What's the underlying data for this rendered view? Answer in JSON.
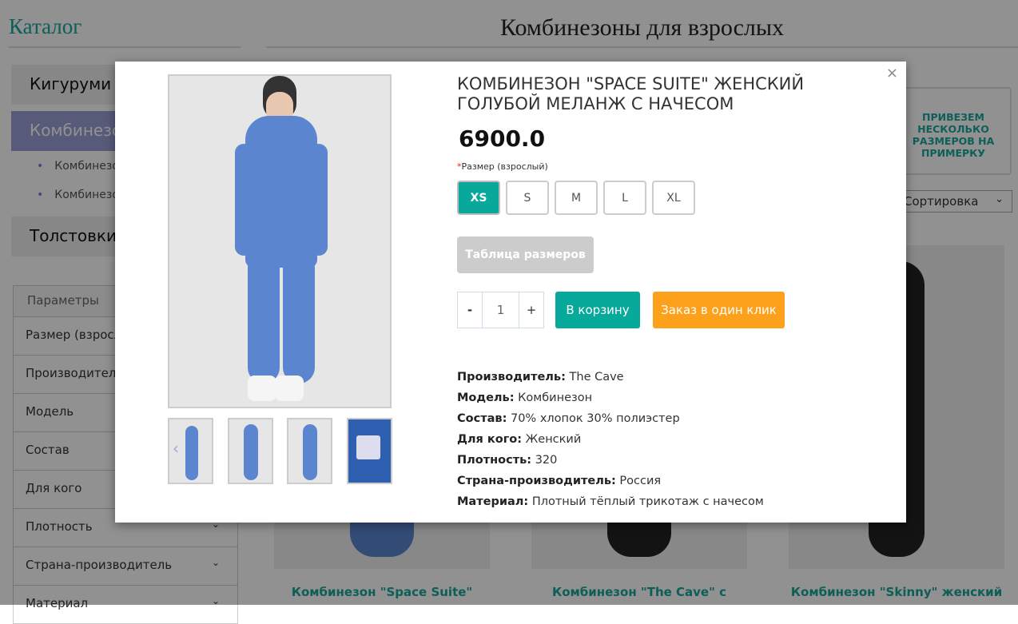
{
  "sidebar": {
    "title": "Каталог",
    "categories": [
      {
        "label": "Кигуруми"
      },
      {
        "label": "Комбинезоны",
        "active": true
      },
      {
        "label": "Толстовки"
      }
    ],
    "subcategories": [
      {
        "label": "Комбинезоны"
      },
      {
        "label": "Комбинезоны"
      }
    ],
    "filters": {
      "header": "Параметры",
      "items": [
        "Размер (взрослый)",
        "Производитель",
        "Модель",
        "Состав",
        "Для кого",
        "Плотность",
        "Страна-производитель",
        "Материал"
      ]
    }
  },
  "header": {
    "title": "Комбинезоны для взрослых"
  },
  "promo": {
    "text": "ПРИВЕЗЕМ НЕСКОЛЬКО РАЗМЕРОВ НА ПРИМЕРКУ"
  },
  "sort": {
    "value": "Сортировка"
  },
  "products": [
    {
      "title": "Комбинезон \"Space Suite\""
    },
    {
      "title": "Комбинезон \"The Cave\" с"
    },
    {
      "title": "Комбинезон \"Skinny\" женский"
    }
  ],
  "modal": {
    "close": "×",
    "title": "Комбинезон \"Space Suite\" женский голубой меланж с начесом",
    "price": "6900.0",
    "size_label": "Размер (взрослый)",
    "required_mark": "*",
    "sizes": [
      "XS",
      "S",
      "M",
      "L",
      "XL"
    ],
    "selected_size": "XS",
    "size_table_button": "Таблица размеров",
    "quantity": {
      "minus": "-",
      "value": "1",
      "plus": "+"
    },
    "cart_button": "В корзину",
    "one_click_button": "Заказ в один клик",
    "thumb_prev": "‹",
    "specs": [
      {
        "label": "Производитель:",
        "value": "The Cave"
      },
      {
        "label": "Модель:",
        "value": "Комбинезон"
      },
      {
        "label": "Состав:",
        "value": "70% хлопок 30% полиэстер"
      },
      {
        "label": "Для кого:",
        "value": "Женский"
      },
      {
        "label": "Плотность:",
        "value": "320"
      },
      {
        "label": "Страна-производитель:",
        "value": "Россия"
      },
      {
        "label": "Материал:",
        "value": "Плотный тёплый трикотаж с начесом"
      }
    ]
  },
  "colors": {
    "accent": "#07a99b",
    "orange": "#fda11d",
    "active_category": "#9b9fd6"
  }
}
